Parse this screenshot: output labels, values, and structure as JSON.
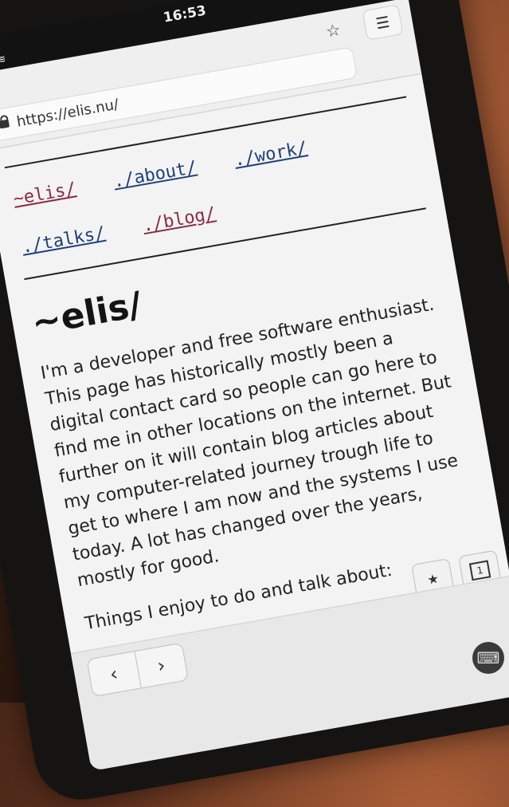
{
  "status": {
    "time": "16:53",
    "icons": [
      "question-icon",
      "wifi-icon"
    ]
  },
  "browser": {
    "url": "https://elis.nu/"
  },
  "nav": {
    "links": [
      {
        "label": "~elis/",
        "visited": true
      },
      {
        "label": "./about/",
        "visited": false
      },
      {
        "label": "./work/",
        "visited": false
      },
      {
        "label": "./talks/",
        "visited": false
      },
      {
        "label": "./blog/",
        "visited": true
      }
    ]
  },
  "page": {
    "title": "~elis/",
    "intro": "I'm a developer and free software enthusiast. This page has historically mostly been a digital contact card so people can go here to find me in other locations on the internet. But further on it will contain blog articles about my computer-related journey trough life to get to where I am now and the systems I use today. A lot has changed over the years, mostly for good.",
    "things_heading": "Things I enjoy to do and talk about:"
  },
  "controls": {
    "tab_count": "1",
    "back": "‹",
    "forward": "›"
  },
  "colors": {
    "link": "#1f3f7d",
    "visited_link": "#8a2a45"
  }
}
